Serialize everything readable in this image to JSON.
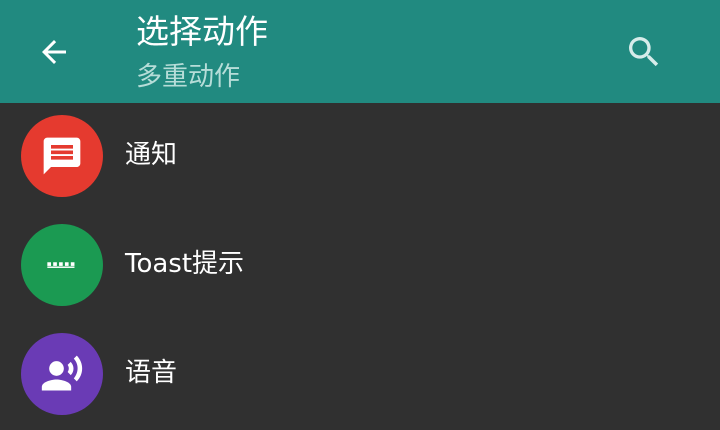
{
  "toolbar": {
    "title": "选择动作",
    "subtitle": "多重动作",
    "back_icon": "arrow-back-icon",
    "search_icon": "search-icon",
    "color": "#218a80"
  },
  "actions": [
    {
      "label": "通知",
      "icon": "notification-message-icon",
      "color": "#e53a2f"
    },
    {
      "label": "Toast提示",
      "icon": "toast-dots-icon",
      "color": "#1b9a52"
    },
    {
      "label": "语音",
      "icon": "voice-speaker-icon",
      "color": "#6a3bb5"
    }
  ],
  "background": "#303030"
}
